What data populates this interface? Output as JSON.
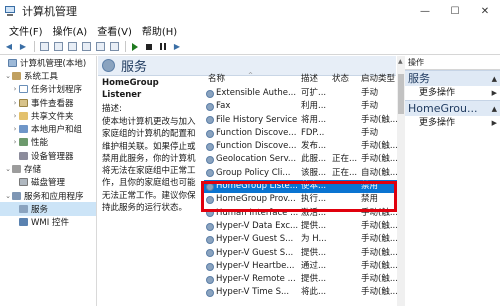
{
  "window": {
    "title": "计算机管理",
    "controls": {
      "minimize": "—",
      "maximize": "☐",
      "close": "✕"
    }
  },
  "menubar": {
    "items": [
      "文件(F)",
      "操作(A)",
      "查看(V)",
      "帮助(H)"
    ]
  },
  "tree": {
    "items": [
      {
        "label": "计算机管理(本地)",
        "arrow": "",
        "icon": "computer-icon"
      },
      {
        "label": "系统工具",
        "arrow": "⌄",
        "icon": "tools-icon"
      },
      {
        "label": "任务计划程序",
        "arrow": "›",
        "icon": "clock-icon"
      },
      {
        "label": "事件查看器",
        "arrow": "›",
        "icon": "event-icon"
      },
      {
        "label": "共享文件夹",
        "arrow": "›",
        "icon": "share-icon"
      },
      {
        "label": "本地用户和组",
        "arrow": "›",
        "icon": "users-icon"
      },
      {
        "label": "性能",
        "arrow": "›",
        "icon": "performance-icon"
      },
      {
        "label": "设备管理器",
        "arrow": "",
        "icon": "device-icon"
      },
      {
        "label": "存储",
        "arrow": "⌄",
        "icon": "storage-icon"
      },
      {
        "label": "磁盘管理",
        "arrow": "",
        "icon": "disk-icon"
      },
      {
        "label": "服务和应用程序",
        "arrow": "⌄",
        "icon": "services-apps-icon"
      },
      {
        "label": "服务",
        "arrow": "",
        "icon": "gear-icon"
      },
      {
        "label": "WMI 控件",
        "arrow": "",
        "icon": "wmi-icon"
      }
    ]
  },
  "services_pane": {
    "title": "服务",
    "selected_name": "HomeGroup Listener",
    "description_label": "描述:",
    "description_text": "使本地计算机更改与加入家庭组的计算机的配置和维护相关联。如果停止或禁用此服务，你的计算机将无法在家庭组中正常工作，且你的家庭组也可能无法正常工作。建议你保持此服务的运行状态。",
    "columns": {
      "name": "名称",
      "desc": "描述",
      "state": "状态",
      "start": "启动类型"
    },
    "rows": [
      {
        "name": "Extensible Authe...",
        "desc": "可扩...",
        "state": "",
        "start": "手动"
      },
      {
        "name": "Fax",
        "desc": "利用...",
        "state": "",
        "start": "手动"
      },
      {
        "name": "File History Service",
        "desc": "将用...",
        "state": "",
        "start": "手动(触..."
      },
      {
        "name": "Function Discove...",
        "desc": "FDP...",
        "state": "",
        "start": "手动"
      },
      {
        "name": "Function Discove...",
        "desc": "发布...",
        "state": "",
        "start": "手动(触..."
      },
      {
        "name": "Geolocation Serv...",
        "desc": "此服...",
        "state": "正在...",
        "start": "手动(触..."
      },
      {
        "name": "Group Policy Cli...",
        "desc": "该服...",
        "state": "正在...",
        "start": "自动(触..."
      },
      {
        "name": "HomeGroup Liste...",
        "desc": "使本...",
        "state": "",
        "start": "禁用"
      },
      {
        "name": "HomeGroup Prov...",
        "desc": "执行...",
        "state": "",
        "start": "禁用"
      },
      {
        "name": "Human Interface ...",
        "desc": "激活...",
        "state": "",
        "start": "手动(触..."
      },
      {
        "name": "Hyper-V Data Exc...",
        "desc": "提供...",
        "state": "",
        "start": "手动(触..."
      },
      {
        "name": "Hyper-V Guest S...",
        "desc": "为 H...",
        "state": "",
        "start": "手动(触..."
      },
      {
        "name": "Hyper-V Guest S...",
        "desc": "提供...",
        "state": "",
        "start": "手动(触..."
      },
      {
        "name": "Hyper-V Heartbe...",
        "desc": "通过...",
        "state": "",
        "start": "手动(触..."
      },
      {
        "name": "Hyper-V Remote ...",
        "desc": "提供...",
        "state": "",
        "start": "手动(触..."
      },
      {
        "name": "Hyper-V Time S...",
        "desc": "将此...",
        "state": "",
        "start": "手动(触..."
      }
    ]
  },
  "actions_pane": {
    "title": "操作",
    "group1": "服务",
    "group1_more": "更多操作",
    "group2": "HomeGrou...",
    "group2_more": "更多操作"
  }
}
